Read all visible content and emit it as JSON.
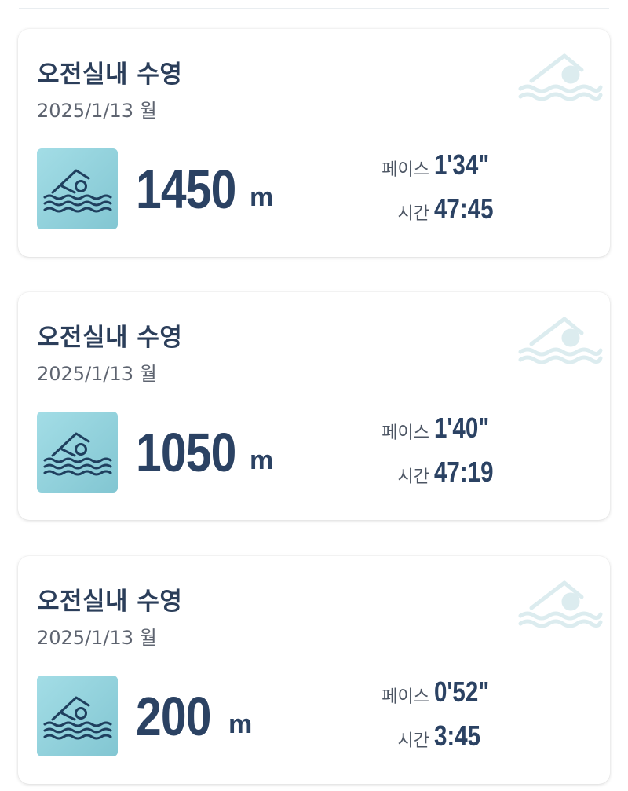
{
  "activities": [
    {
      "title": "오전실내 수영",
      "date": "2025/1/13 월",
      "distance": "1450",
      "distance_unit": "m",
      "pace_label": "페이스",
      "pace": "1'34\"",
      "time_label": "시간",
      "time": "47:45"
    },
    {
      "title": "오전실내 수영",
      "date": "2025/1/13 월",
      "distance": "1050",
      "distance_unit": "m",
      "pace_label": "페이스",
      "pace": "1'40\"",
      "time_label": "시간",
      "time": "47:19"
    },
    {
      "title": "오전실내 수영",
      "date": "2025/1/13 월",
      "distance": "200",
      "distance_unit": "m",
      "pace_label": "페이스",
      "pace": "0'52\"",
      "time_label": "시간",
      "time": "3:45"
    }
  ],
  "icons": {
    "activity": "swimming-icon",
    "watermark": "swimming-watermark-icon"
  },
  "colors": {
    "title": "#2b3e5a",
    "value": "#2b4263",
    "tile": "#8fd1dc",
    "icon_stroke": "#1f3f5e",
    "watermark": "#dcecef"
  }
}
